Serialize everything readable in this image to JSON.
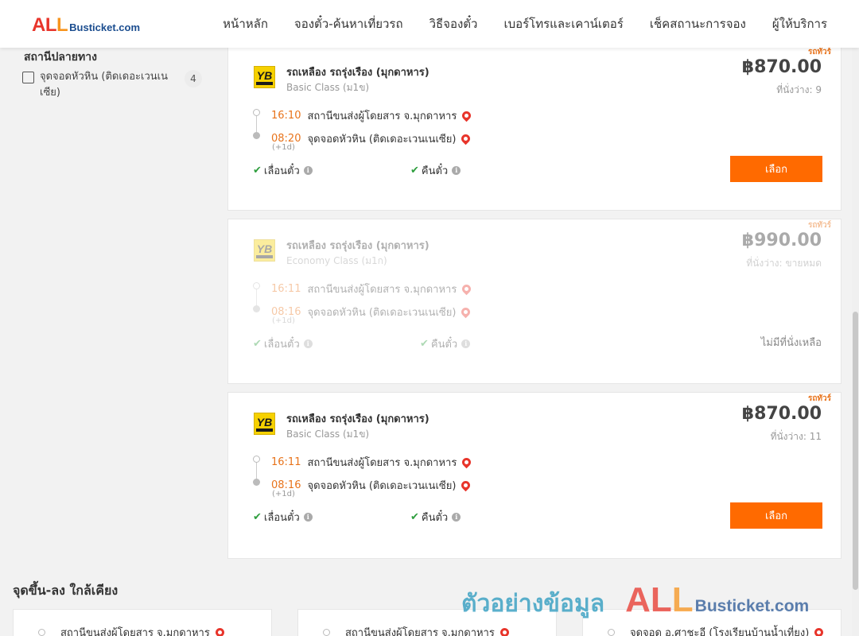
{
  "header": {
    "logo_all": "ALL",
    "logo_busticket": "Busticket.com",
    "nav": [
      "หน้าหลัก",
      "จองตั๋ว-ค้นหาเที่ยวรถ",
      "วิธีจองตั๋ว",
      "เบอร์โทรและเคาน์เตอร์",
      "เช็คสถานะการจอง",
      "ผู้ให้บริการ"
    ]
  },
  "filter": {
    "title": "สถานีปลายทาง",
    "items": [
      {
        "label": "จุดจอดหัวหิน (ติดเดอะเวนเนเซีย)",
        "count": "4",
        "checked": false
      }
    ]
  },
  "results": [
    {
      "tag": "รถทัวร์",
      "operator": "รถเหลือง รถรุ่งเรือง (มุกดาหาร)",
      "class": "Basic Class (ม1ข)",
      "price": "฿870.00",
      "seats": "ที่นั่งว่าง: 9",
      "depart_time": "16:10",
      "depart_place": "สถานีขนส่งผู้โดยสาร จ.มุกดาหาร",
      "arrive_time": "08:20",
      "arrive_place": "จุดจอดหัวหิน (ติดเดอะเวนเนเซีย)",
      "day_offset": "(+1d)",
      "feature1": "เลื่อนตั๋ว",
      "feature2": "คืนตั๋ว",
      "action": "เลือก",
      "available": true
    },
    {
      "tag": "รถทัวร์",
      "operator": "รถเหลือง รถรุ่งเรือง (มุกดาหาร)",
      "class": "Economy Class (ม1ก)",
      "price": "฿990.00",
      "seats": "ที่นั่งว่าง: ขายหมด",
      "depart_time": "16:11",
      "depart_place": "สถานีขนส่งผู้โดยสาร จ.มุกดาหาร",
      "arrive_time": "08:16",
      "arrive_place": "จุดจอดหัวหิน (ติดเดอะเวนเนเซีย)",
      "day_offset": "(+1d)",
      "feature1": "เลื่อนตั๋ว",
      "feature2": "คืนตั๋ว",
      "action": "ไม่มีที่นั่งเหลือ",
      "available": false
    },
    {
      "tag": "รถทัวร์",
      "operator": "รถเหลือง รถรุ่งเรือง (มุกดาหาร)",
      "class": "Basic Class (ม1ข)",
      "price": "฿870.00",
      "seats": "ที่นั่งว่าง: 11",
      "depart_time": "16:11",
      "depart_place": "สถานีขนส่งผู้โดยสาร จ.มุกดาหาร",
      "arrive_time": "08:16",
      "arrive_place": "จุดจอดหัวหิน (ติดเดอะเวนเนเซีย)",
      "day_offset": "(+1d)",
      "feature1": "เลื่อนตั๋ว",
      "feature2": "คืนตั๋ว",
      "action": "เลือก",
      "available": true
    }
  ],
  "nearby": {
    "title": "จุดขึ้น-ลง ใกล้เคียง",
    "items": [
      "สถานีขนส่งผู้โดยสาร จ.มุกดาหาร",
      "สถานีขนส่งผู้โดยสาร จ.มุกดาหาร",
      "จุดจอด อ.ศาชะอี (โรงเรียนบ้านน้ำเที่ยง)"
    ]
  },
  "watermark": {
    "text": "ตัวอย่างข้อมูล",
    "all": "ALL",
    "busticket": "Busticket.com"
  },
  "colors": {
    "accent": "#ff6a00",
    "time": "#e8731b",
    "check": "#2e9e3e",
    "pin": "#e8352b"
  }
}
